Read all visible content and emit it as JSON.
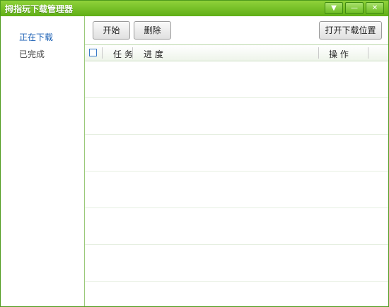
{
  "window": {
    "title": "拇指玩下载管理器",
    "controls": [
      "▼",
      "—",
      "✕"
    ]
  },
  "sidebar": {
    "items": [
      {
        "label": "正在下载",
        "active": true,
        "color": "#1a5fb4"
      },
      {
        "label": "已完成",
        "active": false,
        "color": "#444444"
      }
    ]
  },
  "toolbar": {
    "start_label": "开始",
    "delete_label": "删除",
    "open_location_label": "打开下载位置"
  },
  "table": {
    "headers": {
      "task": "任 务",
      "progress": "进 度",
      "action": "操 作"
    },
    "rows": []
  },
  "colors": {
    "titlebar_accent": "#6fbf22",
    "border": "#4d9a1c"
  }
}
